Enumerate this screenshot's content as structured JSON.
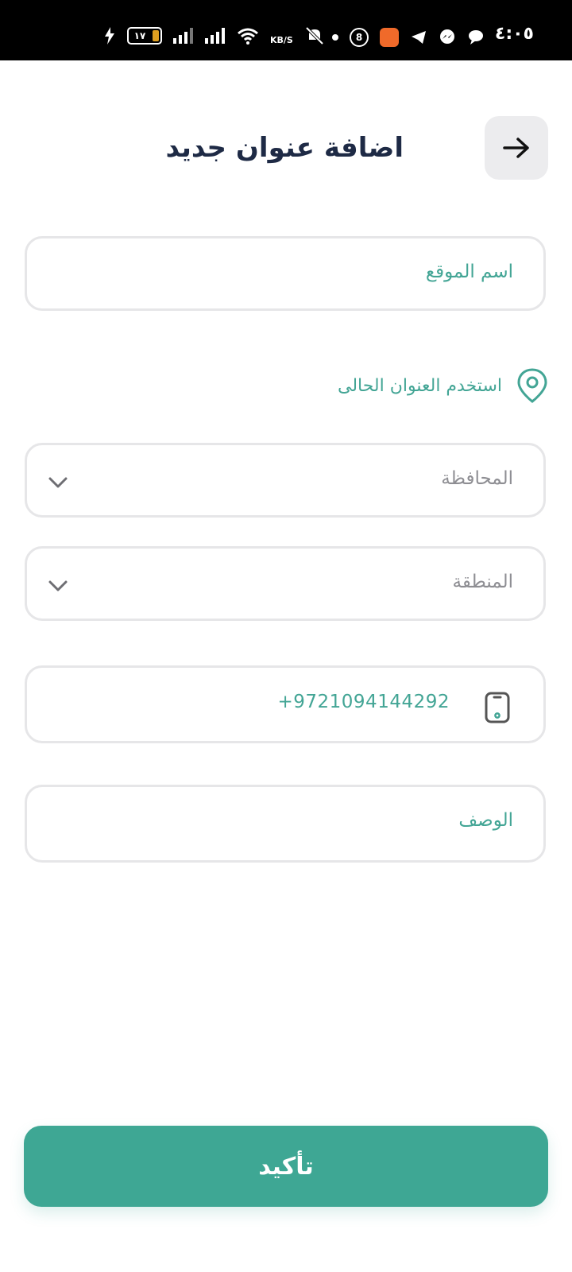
{
  "status_bar": {
    "time": "٤:٠٥",
    "battery_level": "١٧",
    "network_speed_unit": "KB/S",
    "notification_badge": "8",
    "icons": [
      "charging-bolt-icon",
      "battery-icon",
      "signal-icon",
      "signal-icon",
      "wifi-icon",
      "mute-icon",
      "dot-icon",
      "badge-icon",
      "orange-app-icon",
      "telegram-icon",
      "messenger-icon",
      "chat-icon"
    ]
  },
  "header": {
    "title": "اضافة عنوان جديد",
    "back_icon": "arrow-right-icon"
  },
  "form": {
    "site_name": {
      "placeholder": "اسم الموقع"
    },
    "use_current_location": {
      "label": "استخدم العنوان الحالى",
      "icon": "location-pin-icon"
    },
    "governorate": {
      "placeholder": "المحافظة",
      "icon": "chevron-down-icon"
    },
    "region": {
      "placeholder": "المنطقة",
      "icon": "chevron-down-icon"
    },
    "phone": {
      "value": "+9721094144292",
      "icon": "phone-icon"
    },
    "description": {
      "placeholder": "الوصف"
    }
  },
  "actions": {
    "confirm_label": "تأكيد"
  },
  "colors": {
    "accent": "#3ea794",
    "text_teal": "#43a595",
    "title": "#1e2a45",
    "placeholder_grey": "#8e8e93",
    "field_border": "#e6e6e8"
  }
}
